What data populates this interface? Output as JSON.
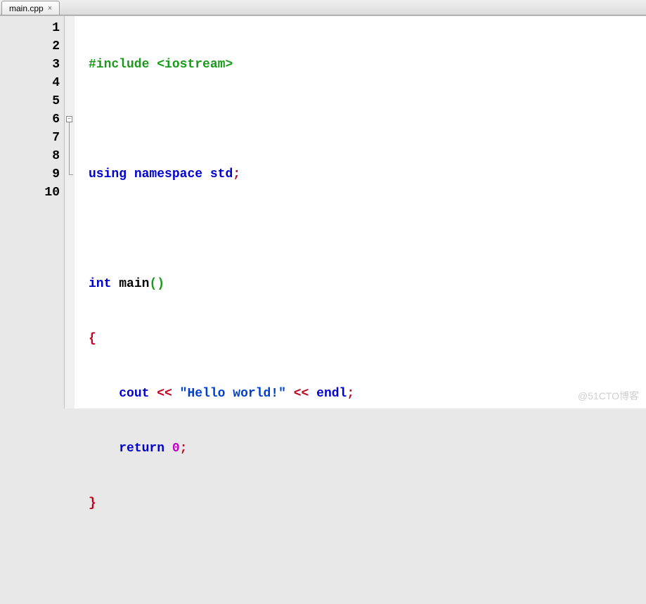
{
  "tab": {
    "filename": "main.cpp",
    "close_glyph": "×"
  },
  "gutter": {
    "lines": [
      "1",
      "2",
      "3",
      "4",
      "5",
      "6",
      "7",
      "8",
      "9",
      "10"
    ]
  },
  "fold": {
    "minus_glyph": "−"
  },
  "code": {
    "l1": {
      "include": "#include",
      "header": "<iostream>"
    },
    "l3": {
      "using": "using",
      "namespace": "namespace",
      "std": "std",
      "semi": ";"
    },
    "l5": {
      "int": "int",
      "main": "main",
      "lp": "(",
      "rp": ")"
    },
    "l6": {
      "lbrace": "{"
    },
    "l7": {
      "indent": "    ",
      "cout": "cout",
      "sp1": " ",
      "op1": "<<",
      "sp2": " ",
      "str": "\"Hello world!\"",
      "sp3": " ",
      "op2": "<<",
      "sp4": " ",
      "endl": "endl",
      "semi": ";"
    },
    "l8": {
      "indent": "    ",
      "return": "return",
      "sp": " ",
      "zero": "0",
      "semi": ";"
    },
    "l9": {
      "rbrace": "}"
    }
  },
  "watermark": "@51CTO博客"
}
